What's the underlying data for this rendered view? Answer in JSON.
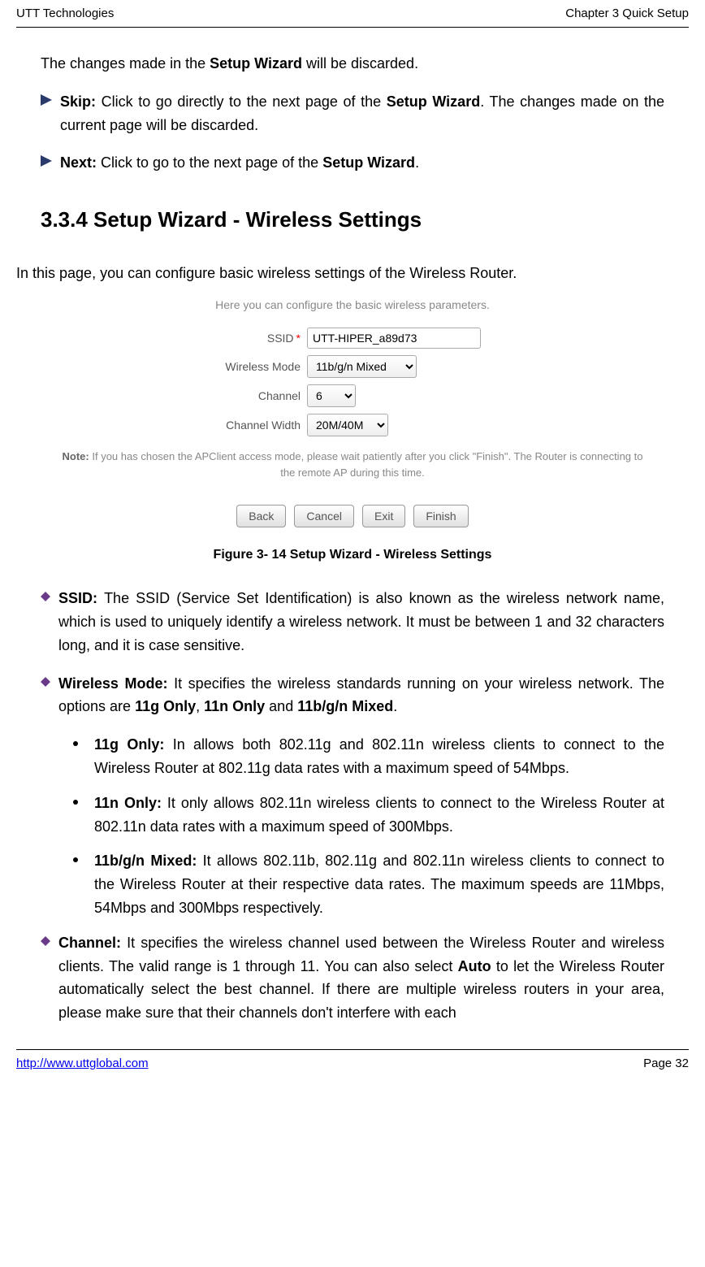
{
  "header": {
    "left": "UTT Technologies",
    "right": "Chapter 3 Quick Setup"
  },
  "para1_pre": "The changes made in the ",
  "para1_bold": "Setup Wizard",
  "para1_post": " will be discarded.",
  "skip": {
    "label": "Skip: ",
    "text_pre": "Click to go directly to the next page of the ",
    "bold": "Setup Wizard",
    "text_post": ". The changes made on the current page will be discarded."
  },
  "next": {
    "label": "Next: ",
    "text_pre": "Click to go to the next page of the ",
    "bold": "Setup Wizard",
    "text_post": "."
  },
  "section_heading": "3.3.4    Setup Wizard - Wireless Settings",
  "intro": "In this page, you can configure basic wireless settings of the Wireless Router.",
  "figure": {
    "description": "Here you can configure the basic wireless parameters.",
    "ssid_label": "SSID",
    "ssid_value": "UTT-HIPER_a89d73",
    "mode_label": "Wireless Mode",
    "mode_value": "11b/g/n Mixed",
    "channel_label": "Channel",
    "channel_value": "6",
    "width_label": "Channel Width",
    "width_value": "20M/40M",
    "note_label": "Note: ",
    "note_text": "If you has chosen the APClient access mode, please wait patiently after you click \"Finish\". The Router is connecting to the remote AP during this time.",
    "buttons": {
      "back": "Back",
      "cancel": "Cancel",
      "exit": "Exit",
      "finish": "Finish"
    },
    "caption": "Figure 3- 14 Setup Wizard - Wireless Settings"
  },
  "ssid_desc": {
    "label": "SSID: ",
    "text": "The SSID (Service Set Identification) is also known as the wireless network name, which is used to uniquely identify a wireless network. It must be between 1 and 32 characters long, and it is case sensitive."
  },
  "mode_desc": {
    "label": "Wireless Mode: ",
    "text_pre": "It specifies the wireless standards running on your wireless network. The options are ",
    "opt1": "11g Only",
    "sep1": ", ",
    "opt2": "11n Only",
    "sep2": " and ",
    "opt3": "11b/g/n Mixed",
    "text_post": "."
  },
  "sub": {
    "g_label": "11g Only: ",
    "g_text": "In allows both 802.11g and 802.11n wireless clients to connect to the Wireless Router at 802.11g data rates with a maximum speed of 54Mbps.",
    "n_label": "11n Only: ",
    "n_text": "It only allows 802.11n wireless clients to connect to the Wireless Router at 802.11n data rates with a maximum speed of 300Mbps.",
    "mix_label": "11b/g/n Mixed: ",
    "mix_text": "It allows 802.11b, 802.11g and 802.11n wireless clients to connect to the Wireless Router at their respective data rates. The maximum speeds are 11Mbps, 54Mbps and 300Mbps respectively."
  },
  "channel_desc": {
    "label": "Channel: ",
    "text_pre": "It specifies the wireless channel used between the Wireless Router and wireless clients. The valid range is 1 through 11. You can also select ",
    "bold": "Auto",
    "text_post": " to let the Wireless Router automatically select the best channel. If there are multiple wireless routers in your area, please make sure that their channels don't interfere with each"
  },
  "footer": {
    "link": "http://www.uttglobal.com",
    "page": "Page 32"
  }
}
